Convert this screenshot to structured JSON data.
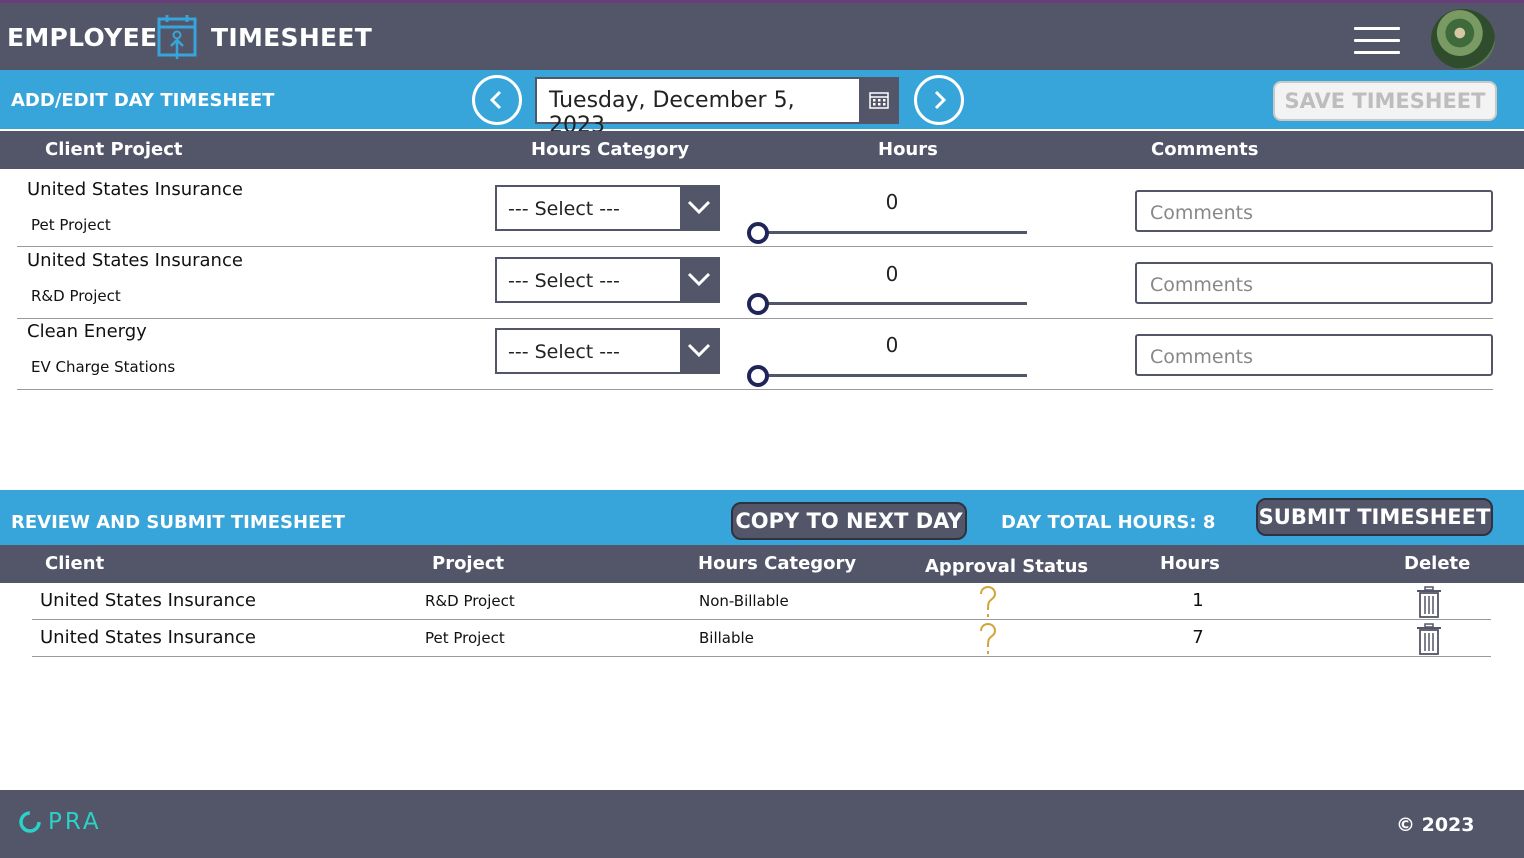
{
  "header": {
    "title_left": "EMPLOYEE",
    "title_right": "TIMESHEET",
    "logo_icon": "calendar-person-icon",
    "menu_icon": "hamburger-menu-icon",
    "avatar": "user-avatar"
  },
  "add_edit": {
    "title": "ADD/EDIT DAY TIMESHEET",
    "date": "Tuesday, December 5, 2023",
    "save_label": "SAVE TIMESHEET",
    "columns": [
      "Client Project",
      "Hours Category",
      "Hours",
      "Comments"
    ],
    "rows": [
      {
        "client": "United States Insurance",
        "project": "Pet Project",
        "category": "--- Select ---",
        "hours": "0",
        "comments_placeholder": "Comments"
      },
      {
        "client": "United States Insurance",
        "project": "R&D Project",
        "category": "--- Select ---",
        "hours": "0",
        "comments_placeholder": "Comments"
      },
      {
        "client": "Clean Energy",
        "project": "EV Charge Stations",
        "category": "--- Select ---",
        "hours": "0",
        "comments_placeholder": "Comments"
      }
    ]
  },
  "review": {
    "title": "REVIEW AND SUBMIT TIMESHEET",
    "copy_label": "COPY TO NEXT DAY",
    "day_total": "DAY TOTAL HOURS: 8",
    "submit_label": "SUBMIT TIMESHEET",
    "columns": [
      "Client",
      "Project",
      "Hours Category",
      "Approval Status",
      "Hours",
      "Delete"
    ],
    "rows": [
      {
        "client": "United States Insurance",
        "project": "R&D Project",
        "category": "Non-Billable",
        "status_icon": "question-mark-icon",
        "hours": "1"
      },
      {
        "client": "United States Insurance",
        "project": "Pet Project",
        "category": "Billable",
        "status_icon": "question-mark-icon",
        "hours": "7"
      }
    ]
  },
  "footer": {
    "brand": "PRA",
    "copyright": "© 2023"
  },
  "colors": {
    "header_bg": "#535669",
    "accent_blue": "#37a4da",
    "brand_teal": "#2bd2c7",
    "pending_gold": "#d4a43a"
  }
}
